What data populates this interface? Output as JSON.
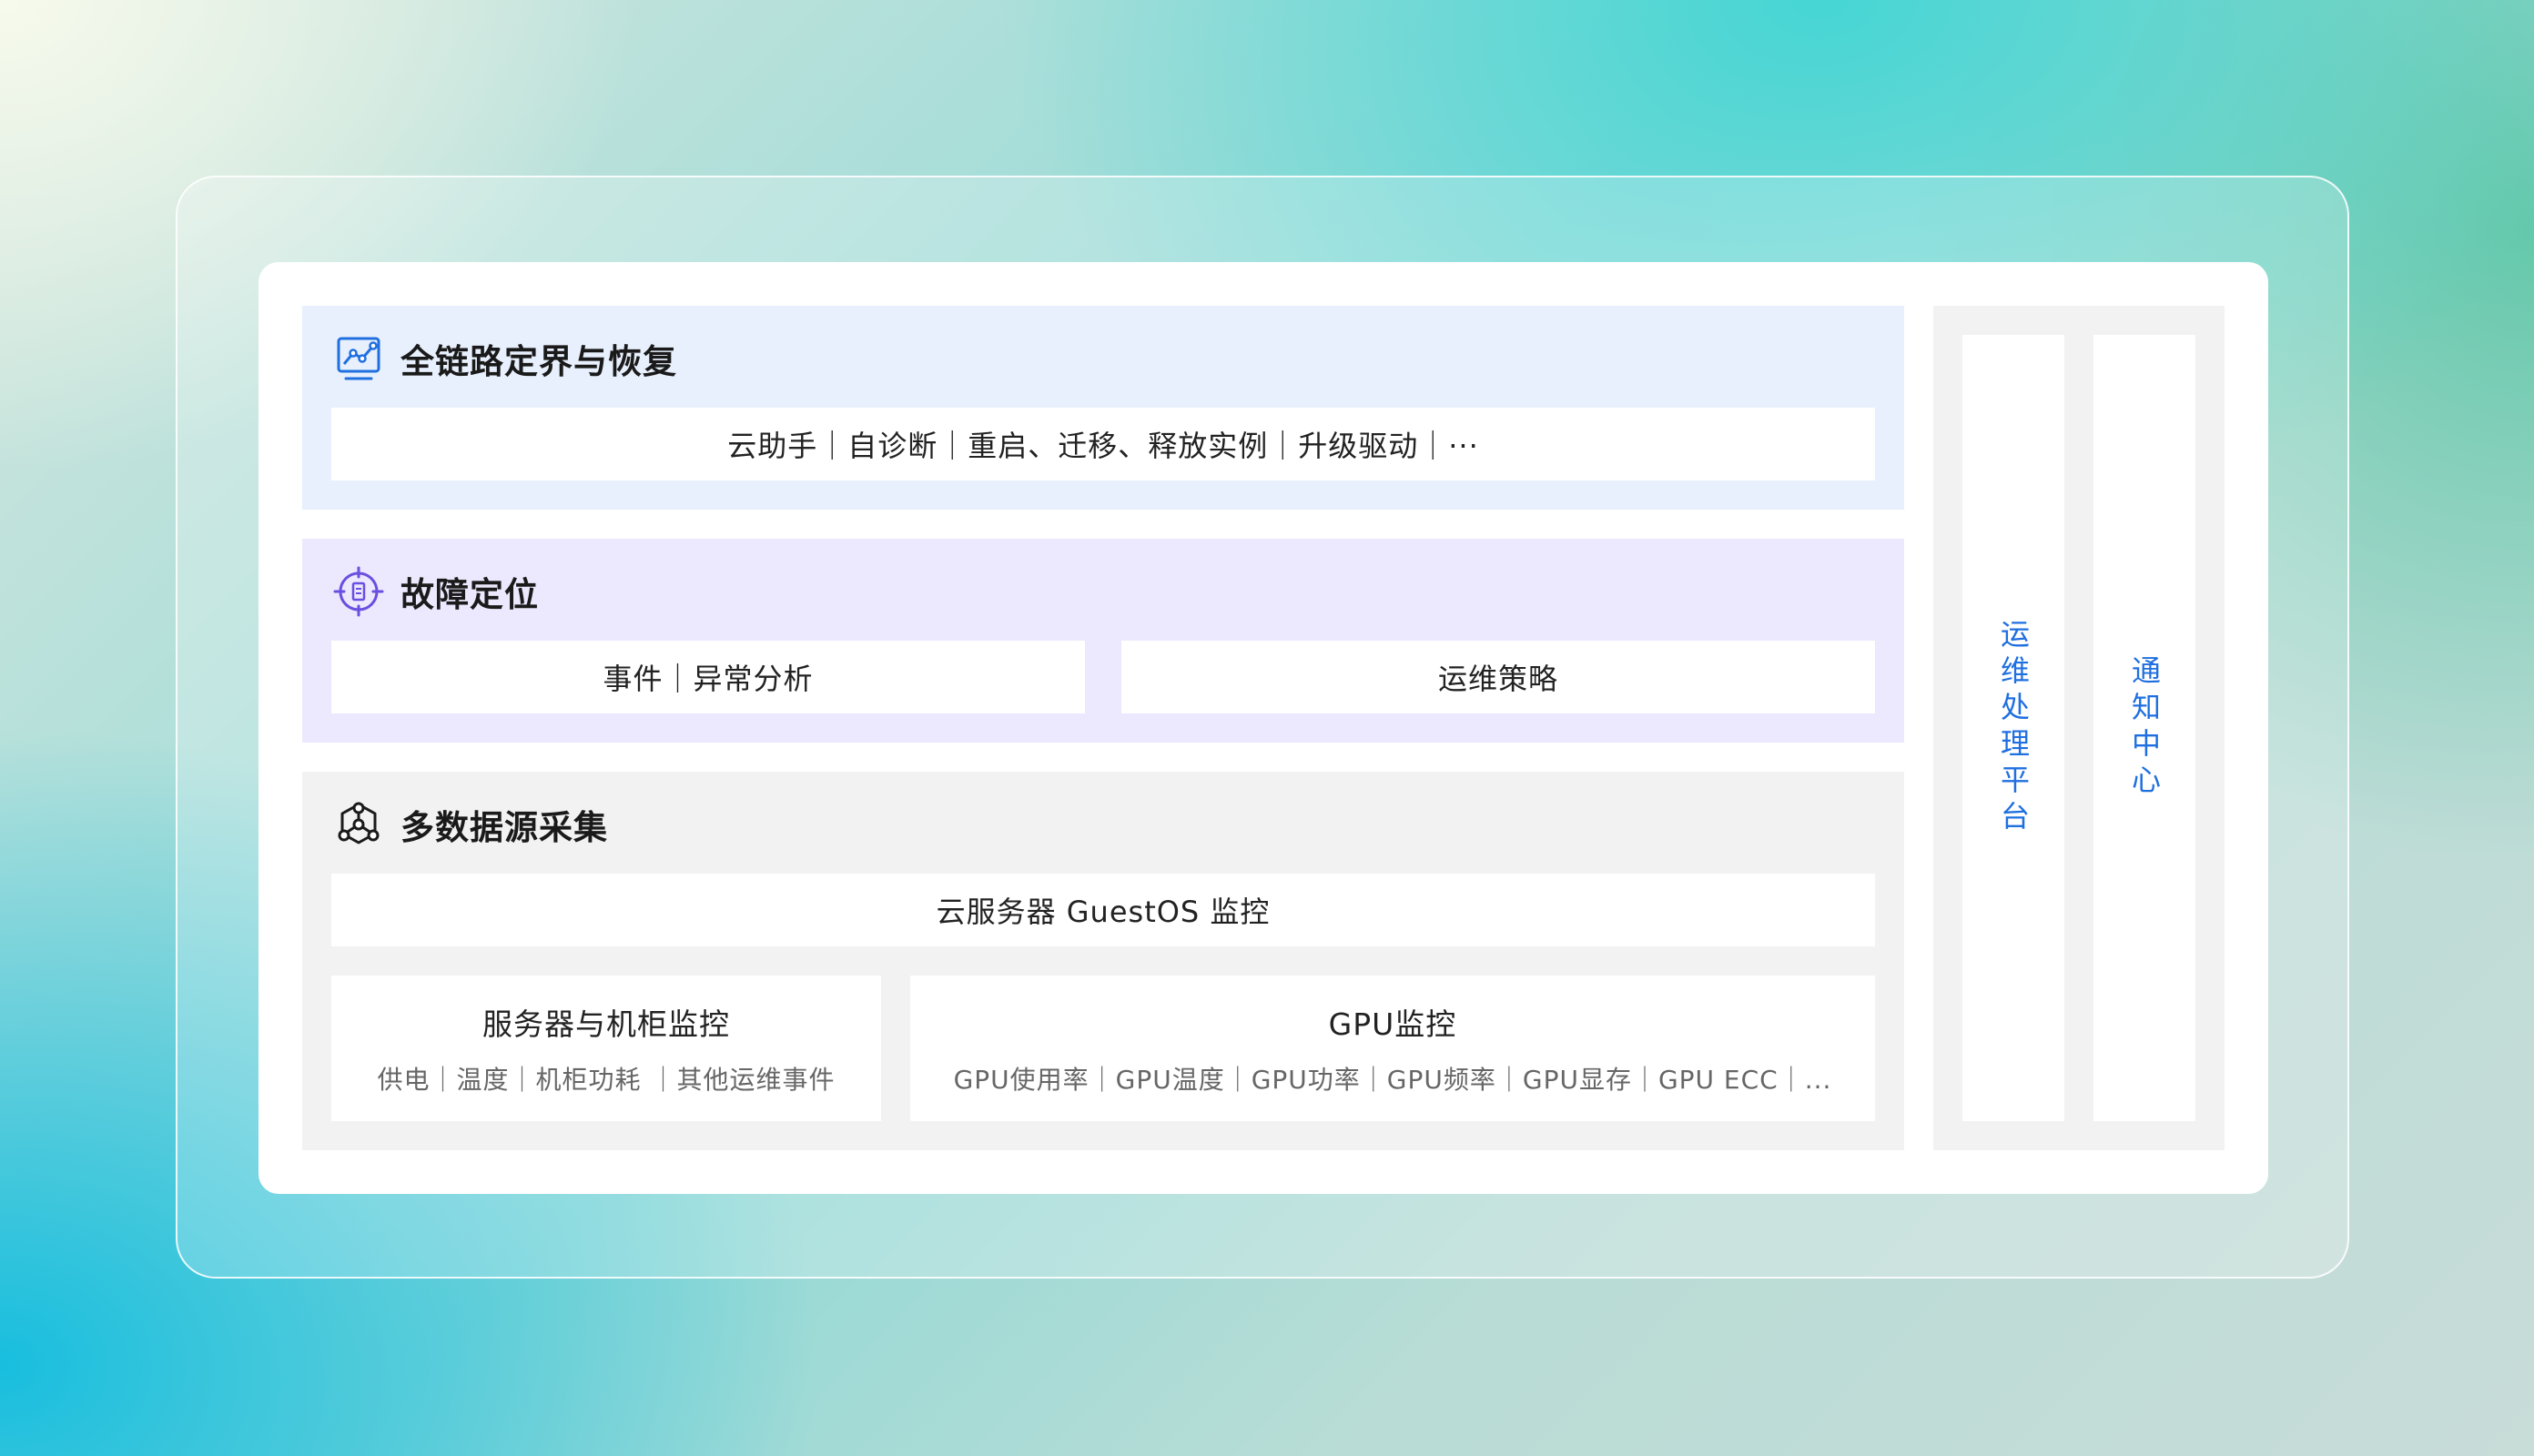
{
  "sections": {
    "fulllink": {
      "title": "全链路定界与恢复",
      "bar": "云助手｜自诊断｜重启、迁移、释放实例｜升级驱动｜···",
      "icon": "link-chart-icon",
      "icon_color": "#1f6fe0"
    },
    "fault": {
      "title": "故障定位",
      "left_box": "事件｜异常分析",
      "right_box": "运维策略",
      "icon": "target-icon",
      "icon_color": "#6a4fe0"
    },
    "data": {
      "title": "多数据源采集",
      "guestos_box": "云服务器 GuestOS 监控",
      "server_box": {
        "title": "服务器与机柜监控",
        "detail": "供电｜温度｜机柜功耗 ｜其他运维事件"
      },
      "gpu_box": {
        "title": "GPU监控",
        "detail": "GPU使用率｜GPU温度｜GPU功率｜GPU频率｜GPU显存｜GPU ECC｜..."
      },
      "icon": "network-nodes-icon",
      "icon_color": "#1a1a1a"
    }
  },
  "side": {
    "ops_platform": "运维处理平台",
    "notification_center": "通知中心",
    "text_color": "#1f6fe0"
  }
}
